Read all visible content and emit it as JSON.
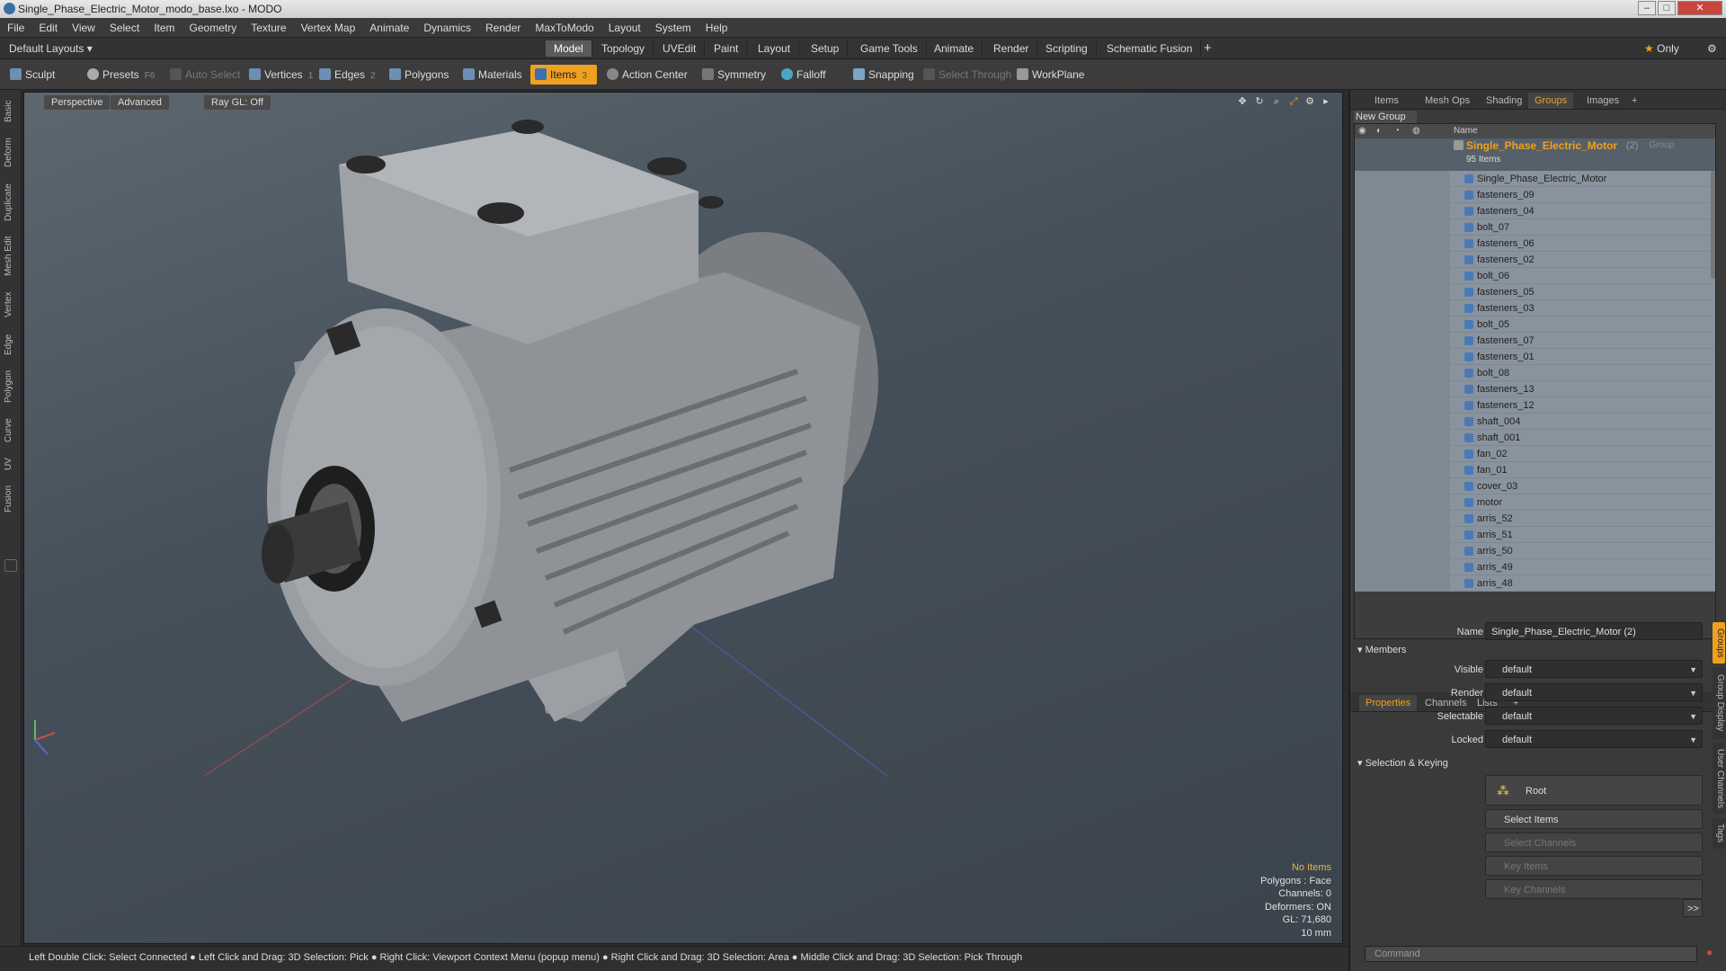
{
  "window": {
    "title": "Single_Phase_Electric_Motor_modo_base.lxo - MODO"
  },
  "menu": [
    "File",
    "Edit",
    "View",
    "Select",
    "Item",
    "Geometry",
    "Texture",
    "Vertex Map",
    "Animate",
    "Dynamics",
    "Render",
    "MaxToModo",
    "Layout",
    "System",
    "Help"
  ],
  "modebar": {
    "layouts_label": "Default Layouts",
    "tabs": [
      "Model",
      "Topology",
      "UVEdit",
      "Paint",
      "Layout",
      "Setup",
      "Game Tools",
      "Animate",
      "Render",
      "Scripting",
      "Schematic Fusion"
    ],
    "only_label": "Only"
  },
  "toolbar": {
    "sculpt": "Sculpt",
    "presets": "Presets",
    "presets_key": "F6",
    "auto_select": "Auto Select",
    "vertices": "Vertices",
    "vertices_count": "1",
    "edges": "Edges",
    "edges_count": "2",
    "polygons": "Polygons",
    "materials": "Materials",
    "items": "Items",
    "items_count": "3",
    "action_center": "Action Center",
    "symmetry": "Symmetry",
    "falloff": "Falloff",
    "snapping": "Snapping",
    "select_through": "Select Through",
    "workplane": "WorkPlane"
  },
  "left_tabs": [
    "Basic",
    "Deform",
    "Duplicate",
    "Mesh Edit",
    "Vertex",
    "Edge",
    "Polygon",
    "Curve",
    "UV",
    "Fusion"
  ],
  "viewport": {
    "perspective": "Perspective",
    "advanced": "Advanced",
    "raygl": "Ray GL: Off",
    "info": {
      "items": "No Items",
      "polygons": "Polygons : Face",
      "channels": "Channels: 0",
      "deformers": "Deformers: ON",
      "gl": "GL: 71,680",
      "size": "10 mm"
    }
  },
  "status": "Left Double Click: Select Connected ● Left Click and Drag: 3D Selection: Pick ● Right Click: Viewport Context Menu (popup menu) ● Right Click and Drag: 3D Selection: Area ● Middle Click and Drag: 3D Selection: Pick Through",
  "panel_tabs": [
    "Items",
    "Mesh Ops",
    "Shading",
    "Groups",
    "Images"
  ],
  "groups": {
    "new_group": "New Group",
    "name_header": "Name",
    "group_name": "Single_Phase_Electric_Motor",
    "group_suffix": "(2)",
    "group_type": ": Group",
    "count": "95 Items",
    "items": [
      "Single_Phase_Electric_Motor",
      "fasteners_09",
      "fasteners_04",
      "bolt_07",
      "fasteners_06",
      "fasteners_02",
      "bolt_06",
      "fasteners_05",
      "fasteners_03",
      "bolt_05",
      "fasteners_07",
      "fasteners_01",
      "bolt_08",
      "fasteners_13",
      "fasteners_12",
      "shaft_004",
      "shaft_001",
      "fan_02",
      "fan_01",
      "cover_03",
      "motor",
      "arris_52",
      "arris_51",
      "arris_50",
      "arris_49",
      "arris_48"
    ]
  },
  "props_tabs": [
    "Properties",
    "Channels",
    "Lists"
  ],
  "properties": {
    "name_label": "Name",
    "name_value": "Single_Phase_Electric_Motor (2)",
    "members": "Members",
    "visible_label": "Visible",
    "render_label": "Render",
    "selectable_label": "Selectable",
    "locked_label": "Locked",
    "default": "default",
    "selection_keying": "Selection & Keying",
    "root": "Root",
    "select_items": "Select Items",
    "select_channels": "Select Channels",
    "key_items": "Key Items",
    "key_channels": "Key Channels",
    "more": ">>"
  },
  "right_vtabs": [
    "Groups",
    "Group Display",
    "User Channels",
    "Tags"
  ],
  "command_placeholder": "Command"
}
